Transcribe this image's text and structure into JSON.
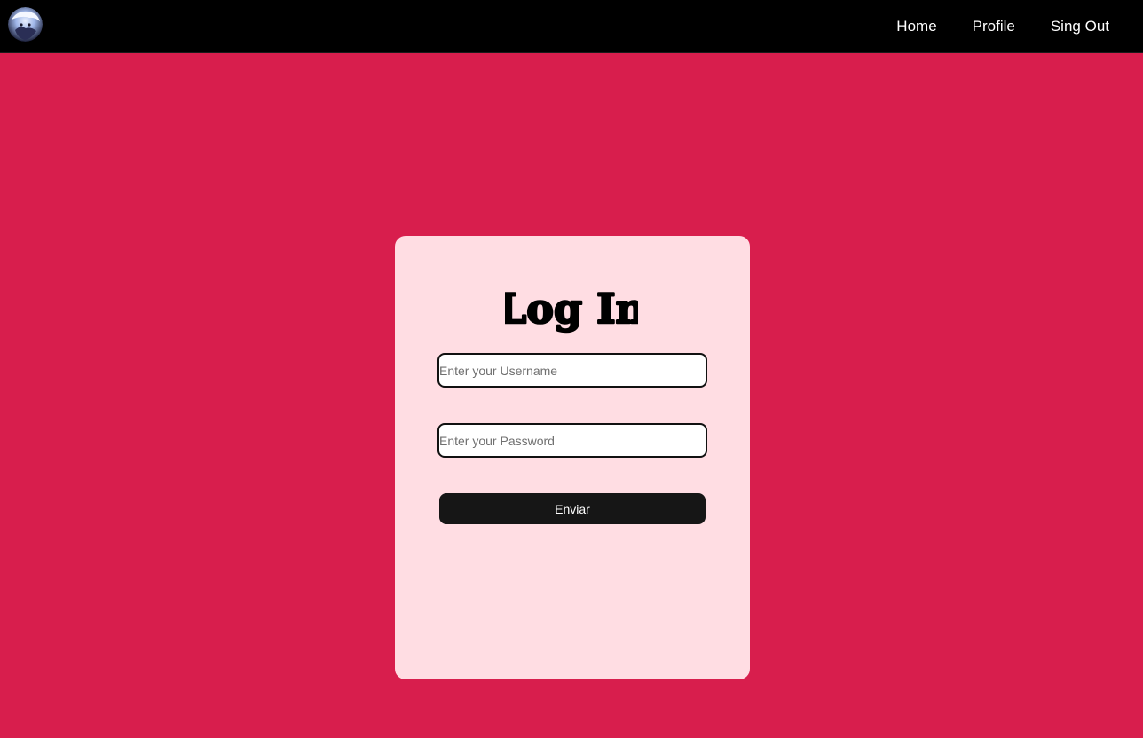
{
  "navbar": {
    "avatar_alt": "user avatar",
    "links": [
      {
        "label": "Home"
      },
      {
        "label": "Profile"
      },
      {
        "label": "Sing Out"
      }
    ]
  },
  "login": {
    "title": "Log In",
    "username": {
      "value": "",
      "placeholder": "Enter your Username"
    },
    "password": {
      "value": "",
      "placeholder": "Enter your Password"
    },
    "submit_label": "Enviar"
  },
  "colors": {
    "background": "#d81e4d",
    "navbar": "#000000",
    "card": "#ffdde3",
    "button": "#161616",
    "text_on_dark": "#ffffff"
  }
}
